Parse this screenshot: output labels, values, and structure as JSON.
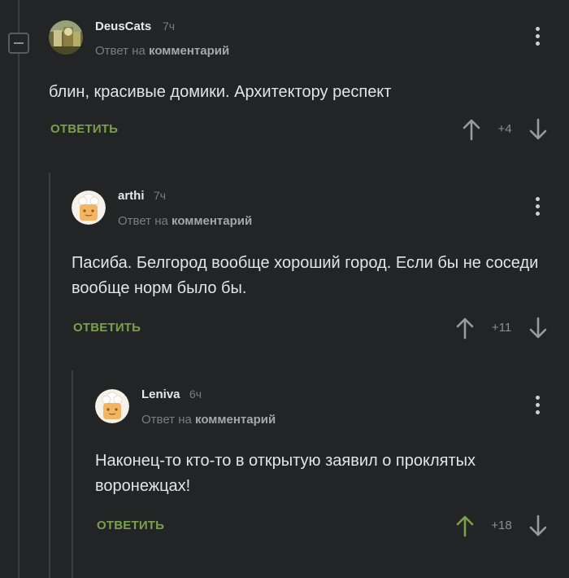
{
  "reply_to_prefix": "Ответ на",
  "reply_to_target": "комментарий",
  "reply_label": "ОТВЕТИТЬ",
  "colors": {
    "accent": "#7aa04d",
    "upvoted": "#7aa04d",
    "neutral": "#9a9b9d",
    "background": "#232425"
  },
  "comments": [
    {
      "author": "DeusCats",
      "time": "7ч",
      "text": "блин, красивые домики. Архитектору респект",
      "score": "+4",
      "avatar": "avatar-photo-icon",
      "upvoted": false
    },
    {
      "author": "arthi",
      "time": "7ч",
      "text": "Пасиба. Белгород вообще хороший город. Если бы не соседи вообще норм было бы.",
      "score": "+11",
      "avatar": "default-avatar-icon",
      "upvoted": false
    },
    {
      "author": "Leniva",
      "time": "6ч",
      "text": "Наконец-то кто-то в открытую заявил о проклятых воронежцах!",
      "score": "+18",
      "avatar": "default-avatar-icon",
      "upvoted": true
    }
  ]
}
